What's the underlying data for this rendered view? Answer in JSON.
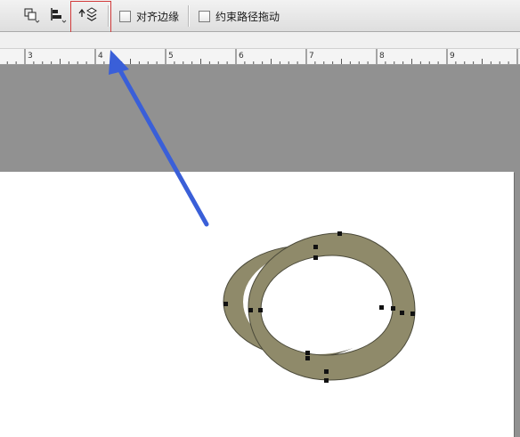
{
  "options_bar": {
    "tools": [
      {
        "name": "path-combine-icon",
        "icon": "path-operations"
      },
      {
        "name": "path-align-icon",
        "icon": "path-alignment"
      },
      {
        "name": "path-arrange-icon",
        "icon": "path-arrangement"
      }
    ],
    "align_edges": {
      "label": "对齐边缘",
      "checked": false
    },
    "constrain_path_dragging": {
      "label": "约束路径拖动",
      "checked": false
    },
    "highlight_color": "#d23b3b"
  },
  "ruler": {
    "labels": [
      "3",
      "4",
      "5",
      "6",
      "7",
      "8",
      "9"
    ]
  },
  "canvas": {
    "document_color": "#ffffff",
    "pasteboard_color": "#919191",
    "ring_fill": "#8f8a6a",
    "anchor_color": "#111111"
  },
  "annotation": {
    "arrow_color": "#3a5fd8"
  }
}
